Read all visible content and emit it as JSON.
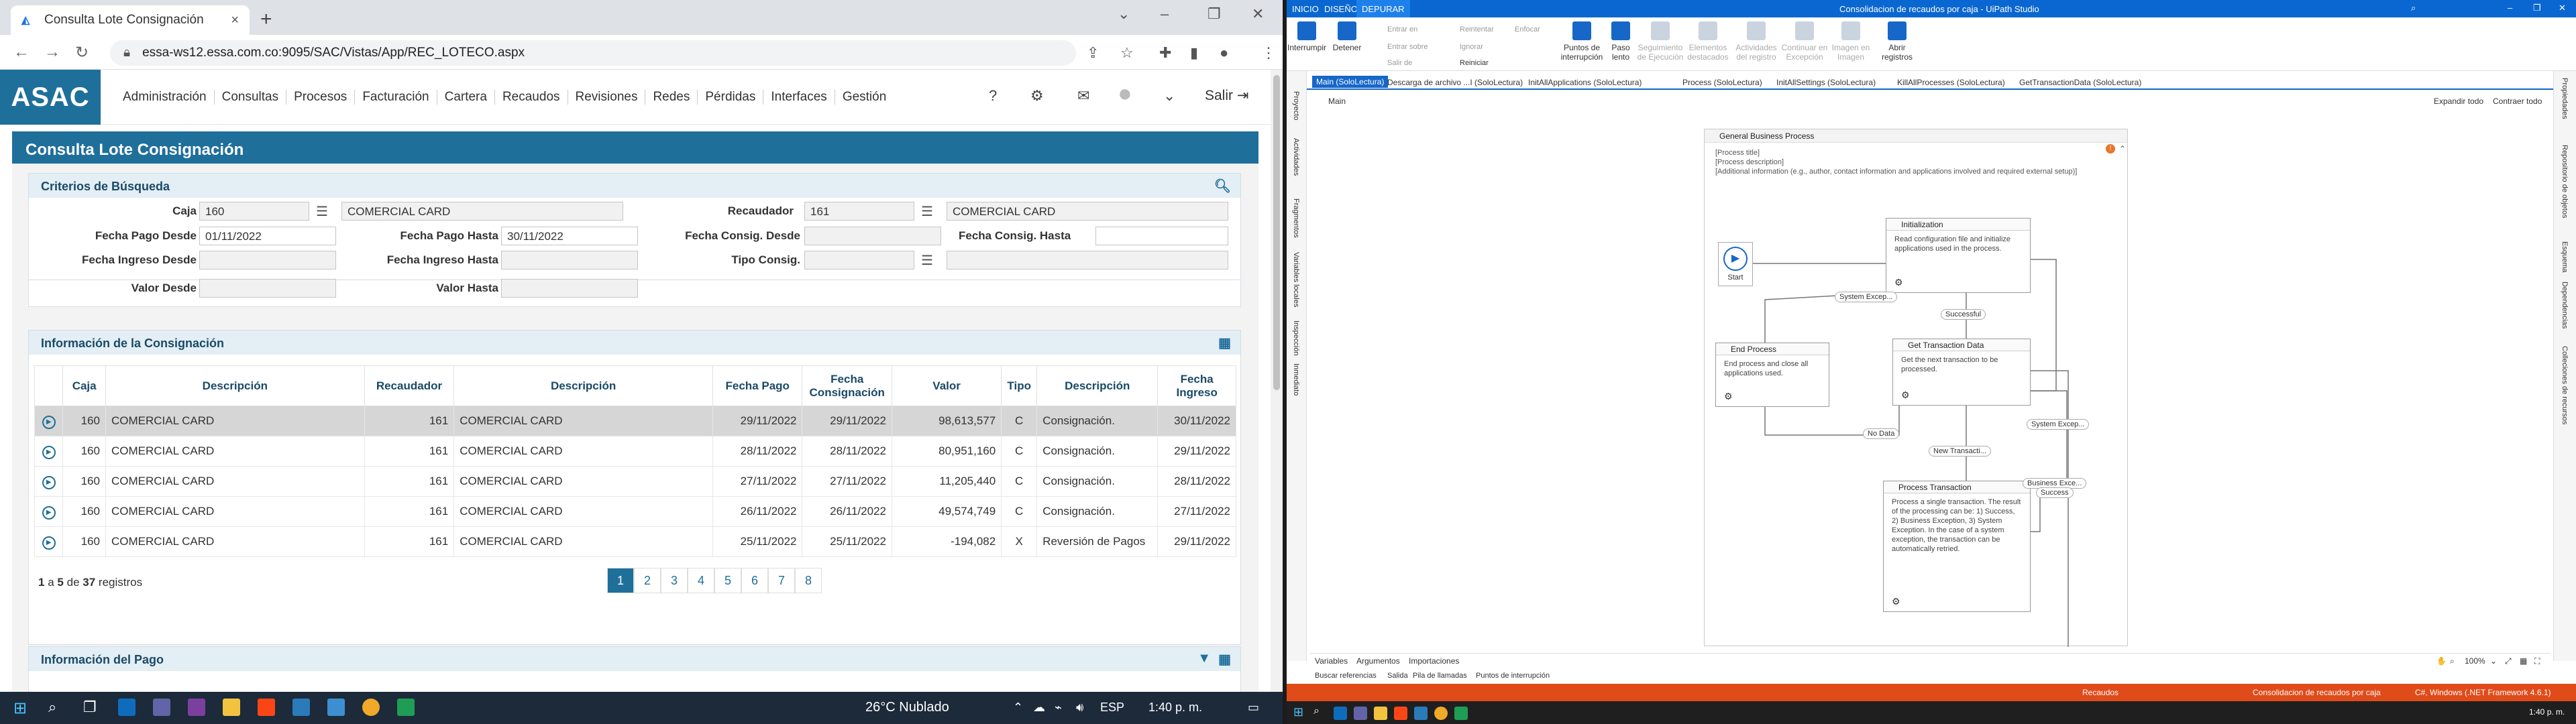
{
  "browser": {
    "tab_title": "Consulta Lote Consignación",
    "new_tab": "+",
    "url": "essa-ws12.essa.com.co:9095/SAC/Vistas/App/REC_LOTECO.aspx"
  },
  "app": {
    "logo": "ASAC",
    "menu": [
      "Administración",
      "Consultas",
      "Procesos",
      "Facturación",
      "Cartera",
      "Recaudos",
      "Revisiones",
      "Redes",
      "Pérdidas",
      "Interfaces",
      "Gestión"
    ],
    "logout_label": "Salir",
    "page_title": "Consulta Lote Consignación"
  },
  "criteria": {
    "title": "Criterios de Búsqueda",
    "labels": {
      "caja": "Caja",
      "recaudador": "Recaudador",
      "fecha_pago_desde": "Fecha Pago Desde",
      "fecha_pago_hasta": "Fecha Pago Hasta",
      "fecha_consig_desde": "Fecha Consig. Desde",
      "fecha_consig_hasta": "Fecha Consig. Hasta",
      "fecha_ingreso_desde": "Fecha Ingreso Desde",
      "fecha_ingreso_hasta": "Fecha Ingreso Hasta",
      "tipo_consig": "Tipo Consig.",
      "valor_desde": "Valor Desde",
      "valor_hasta": "Valor Hasta"
    },
    "values": {
      "caja": "160",
      "caja_desc": "COMERCIAL CARD",
      "recaudador": "161",
      "recaudador_desc": "COMERCIAL CARD",
      "fecha_pago_desde": "01/11/2022",
      "fecha_pago_hasta": "30/11/2022"
    }
  },
  "consignacion": {
    "title": "Información de la Consignación",
    "columns": [
      "",
      "Caja",
      "Descripción",
      "Recaudador",
      "Descripción",
      "Fecha Pago",
      "Fecha Consignación",
      "Valor",
      "Tipo",
      "Descripción",
      "Fecha Ingreso"
    ],
    "rows": [
      [
        "160",
        "COMERCIAL CARD",
        "161",
        "COMERCIAL CARD",
        "29/11/2022",
        "29/11/2022",
        "98,613,577",
        "C",
        "Consignación.",
        "30/11/2022"
      ],
      [
        "160",
        "COMERCIAL CARD",
        "161",
        "COMERCIAL CARD",
        "28/11/2022",
        "28/11/2022",
        "80,951,160",
        "C",
        "Consignación.",
        "29/11/2022"
      ],
      [
        "160",
        "COMERCIAL CARD",
        "161",
        "COMERCIAL CARD",
        "27/11/2022",
        "27/11/2022",
        "11,205,440",
        "C",
        "Consignación.",
        "28/11/2022"
      ],
      [
        "160",
        "COMERCIAL CARD",
        "161",
        "COMERCIAL CARD",
        "26/11/2022",
        "26/11/2022",
        "49,574,749",
        "C",
        "Consignación.",
        "27/11/2022"
      ],
      [
        "160",
        "COMERCIAL CARD",
        "161",
        "COMERCIAL CARD",
        "25/11/2022",
        "25/11/2022",
        "-194,082",
        "X",
        "Reversión de Pagos",
        "29/11/2022"
      ]
    ],
    "records_text": [
      "1",
      "a",
      "5",
      "de",
      "37",
      "registros"
    ],
    "pages": [
      "1",
      "2",
      "3",
      "4",
      "5",
      "6",
      "7",
      "8"
    ]
  },
  "pago": {
    "title": "Información del Pago"
  },
  "studio": {
    "ribbon_tabs": [
      "INICIO",
      "DISEÑO",
      "DEPURAR"
    ],
    "window_title": "Consolidacion de recaudos por caja - UiPath Studio",
    "ribbon_buttons": [
      {
        "label": "Interrumpir"
      },
      {
        "label": "Detener"
      },
      {
        "label": "Puntos de interrupción"
      },
      {
        "label": "Paso lento"
      },
      {
        "label": "Seguimiento de Ejecución"
      },
      {
        "label": "Elementos destacados"
      },
      {
        "label": "Actividades del registro"
      },
      {
        "label": "Continuar en Excepción"
      },
      {
        "label": "Imagen en Imagen"
      },
      {
        "label": "Abrir registros"
      }
    ],
    "ribbon_small": [
      "Entrar en",
      "Entrar sobre",
      "Salir de",
      "Reintentar",
      "Ignorar",
      "Reiniciar",
      "Enfocar"
    ],
    "doc_tabs": [
      "Main (SoloLectura)",
      "Descarga de archivo ...I (SoloLectura)",
      "InitAllApplications (SoloLectura)",
      "Process (SoloLectura)",
      "InitAllSettings (SoloLectura)",
      "KillAllProcesses (SoloLectura)",
      "GetTransactionData (SoloLectura)"
    ],
    "breadcrumb": "Main",
    "expand_all": "Expandir todo",
    "collapse_all": "Contraer todo",
    "flow_title": "General Business Process",
    "annotation": [
      "[Process title]",
      "[Process description]",
      "[Additional information (e.g., author, contact information and applications involved and required external setup)]"
    ],
    "start": "Start",
    "states": {
      "init": {
        "title": "Initialization",
        "body": "Read configuration file and initialize applications used in the process."
      },
      "end": {
        "title": "End Process",
        "body": "End process and close all applications used."
      },
      "get": {
        "title": "Get Transaction Data",
        "body": "Get the next transaction to be processed."
      },
      "process": {
        "title": "Process Transaction",
        "body": "Process a single transaction. The result of the processing can be: 1) Success, 2) Business Exception, 3) System Exception. In the case of a system exception, the transaction can be automatically retried."
      }
    },
    "transitions": [
      "System Excep...",
      "Successful",
      "No Data",
      "New Transacti...",
      "System Excep...",
      "Business Exce...",
      "Success"
    ],
    "left_panels": [
      "Proyecto",
      "Actividades",
      "Fragmentos",
      "Variables locales",
      "Inspección",
      "Inmediato"
    ],
    "right_panels": [
      "Propiedades",
      "Repositorio de objetos",
      "Esquema",
      "Dependencias",
      "Colleciones de recursos"
    ],
    "bottom_tabs": [
      "Variables",
      "Argumentos",
      "Importaciones"
    ],
    "zoom": "100%",
    "output_tabs": [
      "Buscar referencias",
      "Salida",
      "Pila de llamadas",
      "Puntos de interrupción"
    ],
    "status_items": [
      "Recaudos",
      "Consolidacion de recaudos por caja",
      "C#, Windows (.NET Framework 4.6.1)"
    ]
  },
  "taskbar": {
    "weather": "26°C  Nublado",
    "lang": "ESP",
    "time": "1:40 p. m."
  }
}
